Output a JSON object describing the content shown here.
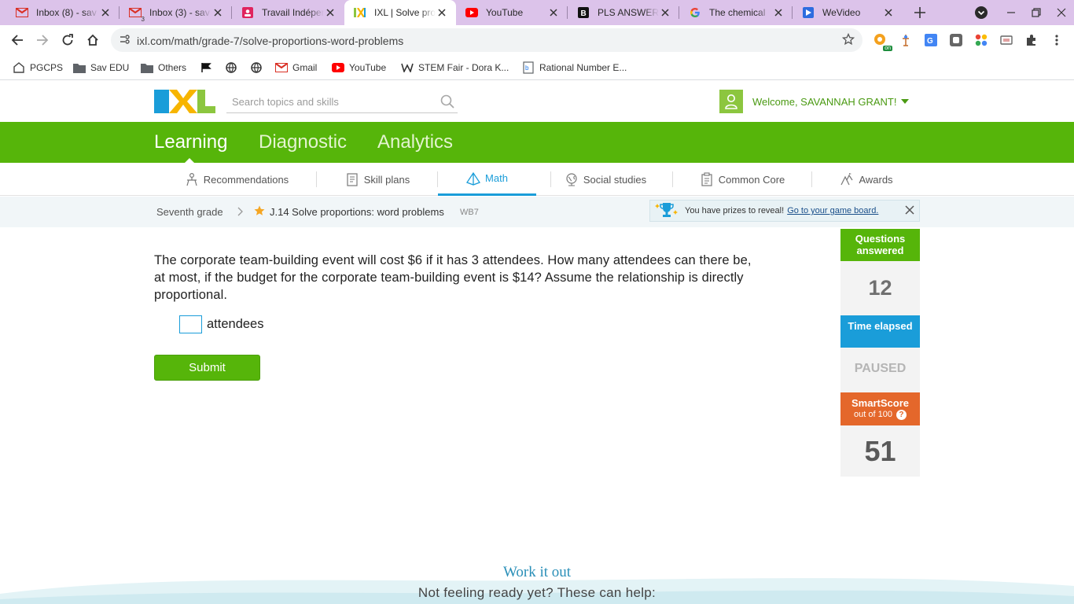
{
  "browser": {
    "tabs": [
      {
        "title": "Inbox (8) - sav",
        "icon": "gmail-icon"
      },
      {
        "title": "Inbox (3) - sav",
        "icon": "gmail-icon",
        "badge": "3"
      },
      {
        "title": "Travail Indépen",
        "icon": "contacts-icon"
      },
      {
        "title": "IXL | Solve pro",
        "icon": "ixl-icon",
        "active": true
      },
      {
        "title": "YouTube",
        "icon": "youtube-icon"
      },
      {
        "title": "PLS ANSWER",
        "icon": "brainly-icon"
      },
      {
        "title": "The chemical",
        "icon": "google-icon"
      },
      {
        "title": "WeVideo",
        "icon": "wevideo-icon"
      }
    ],
    "url": "ixl.com/math/grade-7/solve-proportions-word-problems",
    "extension_badge": "on",
    "bookmarks": [
      {
        "label": "PGCPS",
        "icon": "pgcps-icon"
      },
      {
        "label": "Sav EDU",
        "icon": "folder-icon"
      },
      {
        "label": "Others",
        "icon": "folder-icon"
      },
      {
        "label": "",
        "icon": "flag-icon"
      },
      {
        "label": "",
        "icon": "globe-icon"
      },
      {
        "label": "",
        "icon": "globe-icon"
      },
      {
        "label": "Gmail",
        "icon": "gmail-icon"
      },
      {
        "label": "YouTube",
        "icon": "youtube-icon"
      },
      {
        "label": "STEM Fair - Dora K...",
        "icon": "weebly-icon"
      },
      {
        "label": "Rational Number E...",
        "icon": "doc-icon"
      }
    ]
  },
  "ixl": {
    "search_placeholder": "Search topics and skills",
    "welcome": "Welcome, SAVANNAH GRANT!",
    "main_nav": [
      "Learning",
      "Diagnostic",
      "Analytics"
    ],
    "sub_nav": [
      {
        "label": "Recommendations",
        "icon": "recommendations-icon"
      },
      {
        "label": "Skill plans",
        "icon": "skill-plans-icon"
      },
      {
        "label": "Math",
        "icon": "math-pyramid-icon",
        "active": true
      },
      {
        "label": "Social studies",
        "icon": "globe-icon"
      },
      {
        "label": "Common Core",
        "icon": "common-core-icon"
      },
      {
        "label": "Awards",
        "icon": "awards-icon"
      }
    ],
    "breadcrumb": {
      "grade": "Seventh grade",
      "skill": "J.14 Solve proportions: word problems",
      "code": "WB7"
    },
    "prize": {
      "text": "You have prizes to reveal!",
      "link": "Go to your game board."
    },
    "question": "The corporate team-building event will cost $6 if it has 3 attendees. How many attendees can there be, at most, if the budget for the corporate team-building event is $14? Assume the relationship is directly proportional.",
    "answer_value": "",
    "answer_unit": "attendees",
    "submit_label": "Submit",
    "stats": {
      "questions_label": "Questions answered",
      "questions_value": "12",
      "time_label": "Time elapsed",
      "time_value": "PAUSED",
      "smartscore_label": "SmartScore",
      "smartscore_sub": "out of 100",
      "smartscore_help": "?",
      "smartscore_value": "51"
    },
    "work_it_out": "Work it out",
    "not_ready": "Not feeling ready yet? These can help:"
  },
  "colors": {
    "ixl_green": "#56b50a",
    "ixl_blue": "#1a9dd9",
    "smartscore_orange": "#e4672b",
    "chrome_tabstrip": "#dcc3ea"
  }
}
